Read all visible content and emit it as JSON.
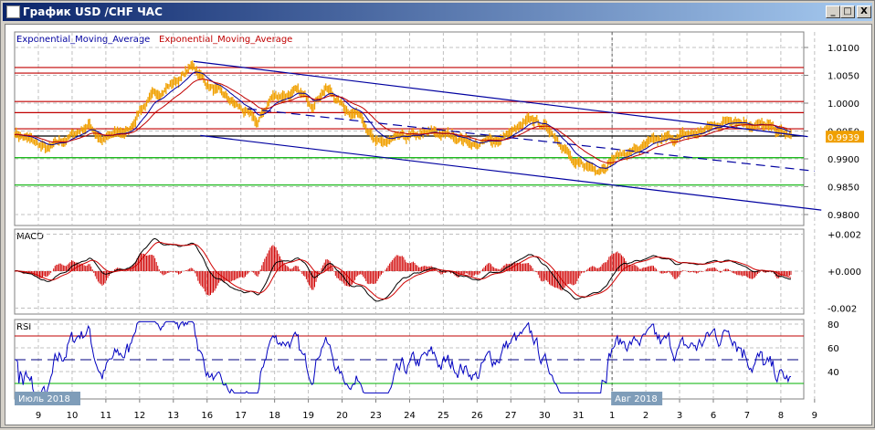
{
  "window": {
    "title": "График USD /CHF  ЧАС",
    "minimize": "_",
    "maximize": "□",
    "close": "X"
  },
  "legend": {
    "ema_blue": "Exponential_Moving_Average",
    "ema_red": "Exponential_Moving_Average"
  },
  "colors": {
    "price": "#f0a000",
    "ema_fast": "#0000a0",
    "ema_slow": "#c00000",
    "level_red": "#c00000",
    "level_green": "#00b000",
    "channel": "#0000a0",
    "grid": "#c0c0c0",
    "rsi_line": "#0000c0",
    "month_label_bg": "#7f9db9"
  },
  "chart_data": [
    {
      "type": "line",
      "title": "USD/CHF H1",
      "ylim": [
        0.978,
        1.013
      ],
      "yticks": [
        "1.0100",
        "1.0050",
        "1.0000",
        "0.9950",
        "0.9900",
        "0.9850",
        "0.9800"
      ],
      "ytick_values": [
        1.01,
        1.005,
        1.0,
        0.995,
        0.99,
        0.985,
        0.98
      ],
      "current_price": "0.9939",
      "current_value": 0.9939,
      "x_ticks": [
        "9",
        "10",
        "11",
        "12",
        "13",
        "16",
        "17",
        "18",
        "19",
        "20",
        "23",
        "24",
        "25",
        "26",
        "27",
        "30",
        "31",
        "1",
        "2",
        "3",
        "6",
        "7",
        "8",
        "9"
      ],
      "month_labels": [
        {
          "label": "Июль 2018",
          "at": 0
        },
        {
          "label": "Авг 2018",
          "at": 17
        }
      ],
      "price_keypoints": [
        [
          -0.7,
          0.9948
        ],
        [
          0.3,
          0.9915
        ],
        [
          0.7,
          0.993
        ],
        [
          1.5,
          0.9962
        ],
        [
          1.9,
          0.9935
        ],
        [
          2.7,
          0.995
        ],
        [
          3.0,
          0.999
        ],
        [
          3.8,
          1.003
        ],
        [
          4.2,
          1.0045
        ],
        [
          4.6,
          1.0068
        ],
        [
          5.0,
          1.0035
        ],
        [
          5.5,
          1.001
        ],
        [
          6.1,
          0.9985
        ],
        [
          6.5,
          0.9962
        ],
        [
          6.9,
          1.001
        ],
        [
          7.6,
          1.002
        ],
        [
          8.1,
          1.0
        ],
        [
          8.5,
          1.003
        ],
        [
          9.1,
          0.999
        ],
        [
          9.6,
          0.998
        ],
        [
          10.0,
          0.9925
        ],
        [
          10.6,
          0.9932
        ],
        [
          11.7,
          0.9945
        ],
        [
          12.5,
          0.994
        ],
        [
          13.0,
          0.9925
        ],
        [
          13.6,
          0.9935
        ],
        [
          14.7,
          0.9968
        ],
        [
          15.2,
          0.995
        ],
        [
          15.6,
          0.9925
        ],
        [
          15.9,
          0.9885
        ],
        [
          16.6,
          0.9885
        ],
        [
          17.1,
          0.9905
        ],
        [
          17.9,
          0.992
        ],
        [
          18.7,
          0.9935
        ],
        [
          19.5,
          0.9945
        ],
        [
          20.6,
          0.9975
        ],
        [
          21.4,
          0.996
        ],
        [
          22.3,
          0.994
        ]
      ],
      "horizontal_levels": [
        {
          "value": 1.0064,
          "color": "red"
        },
        {
          "value": 1.0054,
          "color": "red"
        },
        {
          "value": 1.0003,
          "color": "red"
        },
        {
          "value": 0.9983,
          "color": "red"
        },
        {
          "value": 0.9954,
          "color": "red"
        },
        {
          "value": 0.9941,
          "color": "black"
        },
        {
          "value": 0.9902,
          "color": "green"
        },
        {
          "value": 0.9853,
          "color": "green"
        }
      ],
      "channel": [
        {
          "from": [
            4.6,
            1.0075
          ],
          "to": [
            22.8,
            0.994
          ],
          "style": "solid"
        },
        {
          "from": [
            4.8,
            0.9942
          ],
          "to": [
            23.2,
            0.9808
          ],
          "style": "solid"
        },
        {
          "from": [
            6.2,
            0.999
          ],
          "to": [
            23.0,
            0.9878
          ],
          "style": "dashed"
        }
      ],
      "marker_day": 17
    },
    {
      "type": "bar+line",
      "title": "MACD",
      "ylim": [
        -0.0025,
        0.0025
      ],
      "yticks": [
        "+0.002",
        "+0.000",
        "-0.002"
      ],
      "ytick_values": [
        0.002,
        0,
        -0.002
      ]
    },
    {
      "type": "line",
      "title": "RSI",
      "ylim": [
        20,
        85
      ],
      "yticks": [
        "80",
        "60",
        "40"
      ],
      "ytick_values": [
        80,
        60,
        40
      ],
      "levels": [
        70,
        50,
        30
      ]
    }
  ]
}
